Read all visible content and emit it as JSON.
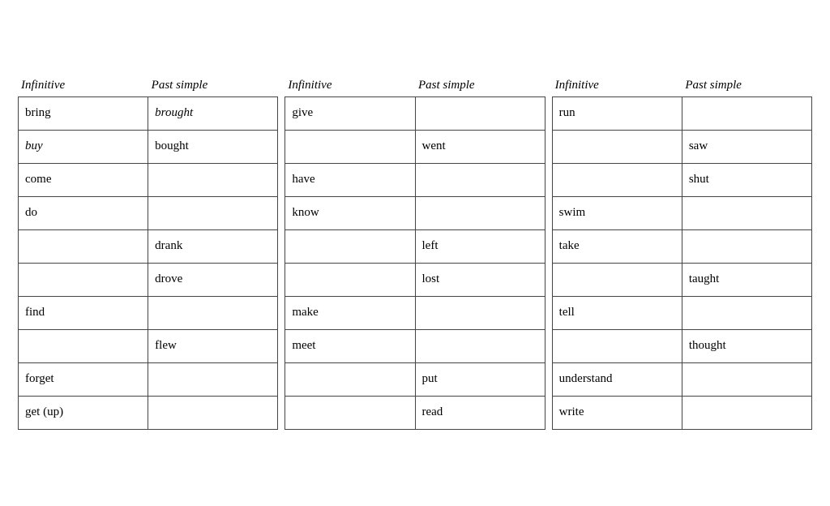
{
  "headers": {
    "infinitive": "Infinitive",
    "past_simple": "Past simple"
  },
  "columns": [
    {
      "id": "col1",
      "rows": [
        {
          "infinitive": "bring",
          "past_simple": "brought",
          "past_italic": true
        },
        {
          "infinitive": "buy",
          "infinitive_italic": true,
          "past_simple": "bought"
        },
        {
          "infinitive": "come",
          "past_simple": ""
        },
        {
          "infinitive": "do",
          "past_simple": ""
        },
        {
          "infinitive": "",
          "past_simple": "drank"
        },
        {
          "infinitive": "",
          "past_simple": "drove"
        },
        {
          "infinitive": "find",
          "past_simple": ""
        },
        {
          "infinitive": "",
          "past_simple": "flew"
        },
        {
          "infinitive": "forget",
          "past_simple": ""
        },
        {
          "infinitive": "get (up)",
          "past_simple": ""
        }
      ]
    },
    {
      "id": "col2",
      "rows": [
        {
          "infinitive": "give",
          "past_simple": ""
        },
        {
          "infinitive": "",
          "past_simple": "went"
        },
        {
          "infinitive": "have",
          "past_simple": ""
        },
        {
          "infinitive": "know",
          "past_simple": ""
        },
        {
          "infinitive": "",
          "past_simple": "left"
        },
        {
          "infinitive": "",
          "past_simple": "lost"
        },
        {
          "infinitive": "make",
          "past_simple": ""
        },
        {
          "infinitive": "meet",
          "past_simple": ""
        },
        {
          "infinitive": "",
          "past_simple": "put"
        },
        {
          "infinitive": "",
          "past_simple": "read"
        }
      ]
    },
    {
      "id": "col3",
      "rows": [
        {
          "infinitive": "run",
          "past_simple": ""
        },
        {
          "infinitive": "",
          "past_simple": "saw"
        },
        {
          "infinitive": "",
          "past_simple": "shut"
        },
        {
          "infinitive": "swim",
          "past_simple": ""
        },
        {
          "infinitive": "take",
          "past_simple": ""
        },
        {
          "infinitive": "",
          "past_simple": "taught"
        },
        {
          "infinitive": "tell",
          "past_simple": ""
        },
        {
          "infinitive": "",
          "past_simple": "thought"
        },
        {
          "infinitive": "understand",
          "past_simple": ""
        },
        {
          "infinitive": "write",
          "past_simple": ""
        }
      ]
    }
  ]
}
